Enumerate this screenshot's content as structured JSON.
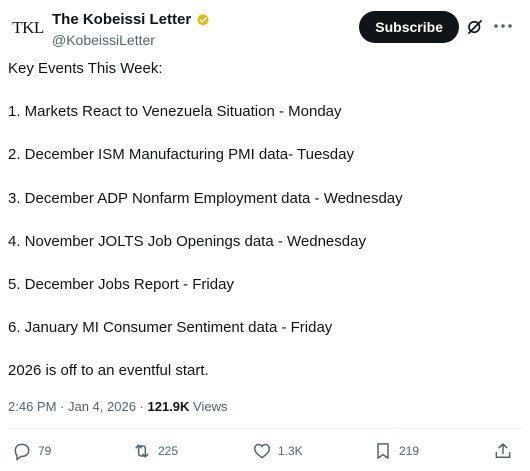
{
  "author": {
    "display_name": "The Kobeissi Letter",
    "handle": "@KobeissiLetter",
    "avatar_text": "TKL",
    "verified_color": "#e2b719"
  },
  "header": {
    "subscribe_label": "Subscribe",
    "grok_icon": "grok-icon",
    "more_icon": "more-icon"
  },
  "tweet": {
    "lines": [
      "Key Events This Week:",
      "1. Markets React to Venezuela Situation - Monday",
      "2. December ISM Manufacturing PMI data- Tuesday",
      "3. December ADP Nonfarm Employment data - Wednesday",
      "4. November JOLTS Job Openings data - Wednesday",
      "5. December Jobs Report - Friday",
      "6. January MI Consumer Sentiment data - Friday",
      "2026 is off to an eventful start."
    ]
  },
  "meta": {
    "time": "2:46 PM",
    "separator": " · ",
    "date": "Jan 4, 2026",
    "views_count": "121.9K",
    "views_label": " Views"
  },
  "actions": {
    "replies": "79",
    "reposts": "225",
    "likes": "1.3K",
    "bookmarks": "219"
  },
  "colors": {
    "text": "#0f1419",
    "secondary": "#536471",
    "button_bg": "#0f1419"
  }
}
